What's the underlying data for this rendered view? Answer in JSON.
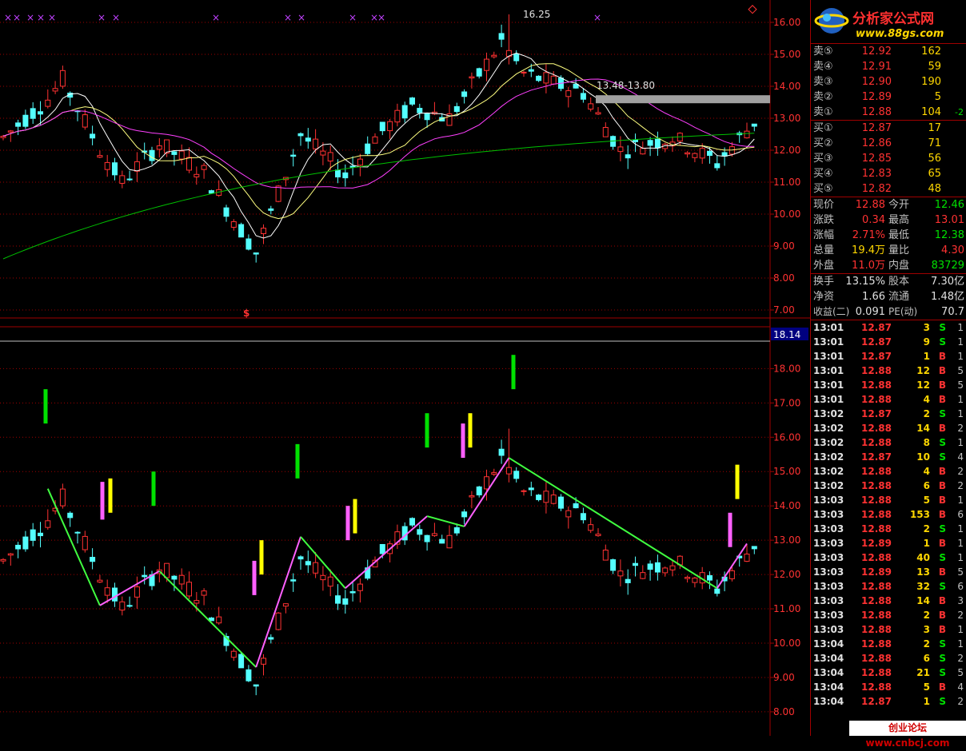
{
  "colors": {
    "up": "#ff3232",
    "down": "#54ffff",
    "ma5": "#ffffff",
    "ma10": "#ffff80",
    "ma20": "#ff40ff",
    "ma60": "#00c000",
    "grid": "#a00000",
    "signal_green": "#00e000",
    "signal_pink": "#ff60ff",
    "signal_yellow": "#ffff00",
    "zigzag_up": "#ff60ff",
    "zigzag_down": "#40ff40"
  },
  "main_chart": {
    "annotations": {
      "peak_label": "16.25",
      "range_label": "13.48-13.80",
      "marker_symbol": "$"
    },
    "y_ticks": [
      "16.00",
      "15.00",
      "14.00",
      "13.00",
      "12.00",
      "11.00",
      "10.00",
      "9.00",
      "8.00",
      "7.00"
    ],
    "top_markers_symbol": "×"
  },
  "lower_chart": {
    "current_value_label": "18.14",
    "y_ticks": [
      "18.00",
      "17.00",
      "16.00",
      "15.00",
      "14.00",
      "13.00",
      "12.00",
      "11.00",
      "10.00",
      "9.00",
      "8.00"
    ]
  },
  "logo": {
    "title": "分析家公式网",
    "url": "www.88gs.com"
  },
  "order_book": {
    "asks": [
      {
        "label": "卖⑤",
        "price": "12.92",
        "vol": "162",
        "chg": ""
      },
      {
        "label": "卖④",
        "price": "12.91",
        "vol": "59",
        "chg": ""
      },
      {
        "label": "卖③",
        "price": "12.90",
        "vol": "190",
        "chg": ""
      },
      {
        "label": "卖②",
        "price": "12.89",
        "vol": "5",
        "chg": ""
      },
      {
        "label": "卖①",
        "price": "12.88",
        "vol": "104",
        "chg": "-2"
      }
    ],
    "bids": [
      {
        "label": "买①",
        "price": "12.87",
        "vol": "17"
      },
      {
        "label": "买②",
        "price": "12.86",
        "vol": "71"
      },
      {
        "label": "买③",
        "price": "12.85",
        "vol": "56"
      },
      {
        "label": "买④",
        "price": "12.83",
        "vol": "65"
      },
      {
        "label": "买⑤",
        "price": "12.82",
        "vol": "48"
      }
    ]
  },
  "stats1": [
    {
      "l1": "现价",
      "v1": "12.88",
      "c1": "red",
      "l2": "今开",
      "v2": "12.46",
      "c2": "green"
    },
    {
      "l1": "涨跌",
      "v1": "0.34",
      "c1": "red",
      "l2": "最高",
      "v2": "13.01",
      "c2": "red"
    },
    {
      "l1": "涨幅",
      "v1": "2.71%",
      "c1": "red",
      "l2": "最低",
      "v2": "12.38",
      "c2": "green"
    },
    {
      "l1": "总量",
      "v1": "19.4万",
      "c1": "yellow",
      "l2": "量比",
      "v2": "4.30",
      "c2": "red"
    },
    {
      "l1": "外盘",
      "v1": "11.0万",
      "c1": "red",
      "l2": "内盘",
      "v2": "83729",
      "c2": "green"
    }
  ],
  "stats2": [
    {
      "l1": "换手",
      "v1": "13.15%",
      "l2": "股本",
      "v2": "7.30亿"
    },
    {
      "l1": "净资",
      "v1": "1.66",
      "l2": "流通",
      "v2": "1.48亿"
    },
    {
      "l1": "收益(二)",
      "v1": "0.091",
      "l2": "PE(动)",
      "v2": "70.7"
    }
  ],
  "ticks": [
    {
      "t": "13:01",
      "p": "12.87",
      "v": "3",
      "s": "S",
      "n": "1"
    },
    {
      "t": "13:01",
      "p": "12.87",
      "v": "9",
      "s": "S",
      "n": "1"
    },
    {
      "t": "13:01",
      "p": "12.87",
      "v": "1",
      "s": "B",
      "n": "1"
    },
    {
      "t": "13:01",
      "p": "12.88",
      "v": "12",
      "s": "B",
      "n": "5"
    },
    {
      "t": "13:01",
      "p": "12.88",
      "v": "12",
      "s": "B",
      "n": "5"
    },
    {
      "t": "13:01",
      "p": "12.88",
      "v": "4",
      "s": "B",
      "n": "1"
    },
    {
      "t": "13:02",
      "p": "12.87",
      "v": "2",
      "s": "S",
      "n": "1"
    },
    {
      "t": "13:02",
      "p": "12.88",
      "v": "14",
      "s": "B",
      "n": "2"
    },
    {
      "t": "13:02",
      "p": "12.88",
      "v": "8",
      "s": "S",
      "n": "1"
    },
    {
      "t": "13:02",
      "p": "12.87",
      "v": "10",
      "s": "S",
      "n": "4"
    },
    {
      "t": "13:02",
      "p": "12.88",
      "v": "4",
      "s": "B",
      "n": "2"
    },
    {
      "t": "13:02",
      "p": "12.88",
      "v": "6",
      "s": "B",
      "n": "2"
    },
    {
      "t": "13:03",
      "p": "12.88",
      "v": "5",
      "s": "B",
      "n": "1"
    },
    {
      "t": "13:03",
      "p": "12.88",
      "v": "153",
      "s": "B",
      "n": "6"
    },
    {
      "t": "13:03",
      "p": "12.88",
      "v": "2",
      "s": "S",
      "n": "1"
    },
    {
      "t": "13:03",
      "p": "12.89",
      "v": "1",
      "s": "B",
      "n": "1"
    },
    {
      "t": "13:03",
      "p": "12.88",
      "v": "40",
      "s": "S",
      "n": "1"
    },
    {
      "t": "13:03",
      "p": "12.89",
      "v": "13",
      "s": "B",
      "n": "5"
    },
    {
      "t": "13:03",
      "p": "12.88",
      "v": "32",
      "s": "S",
      "n": "6"
    },
    {
      "t": "13:03",
      "p": "12.88",
      "v": "14",
      "s": "B",
      "n": "3"
    },
    {
      "t": "13:03",
      "p": "12.88",
      "v": "2",
      "s": "B",
      "n": "2"
    },
    {
      "t": "13:03",
      "p": "12.88",
      "v": "3",
      "s": "B",
      "n": "1"
    },
    {
      "t": "13:04",
      "p": "12.88",
      "v": "2",
      "s": "S",
      "n": "1"
    },
    {
      "t": "13:04",
      "p": "12.88",
      "v": "6",
      "s": "S",
      "n": "2"
    },
    {
      "t": "13:04",
      "p": "12.88",
      "v": "21",
      "s": "S",
      "n": "5"
    },
    {
      "t": "13:04",
      "p": "12.88",
      "v": "5",
      "s": "B",
      "n": "4"
    },
    {
      "t": "13:04",
      "p": "12.87",
      "v": "1",
      "s": "S",
      "n": "2"
    }
  ],
  "watermark": "创业论坛 www.cnbcj.com"
}
